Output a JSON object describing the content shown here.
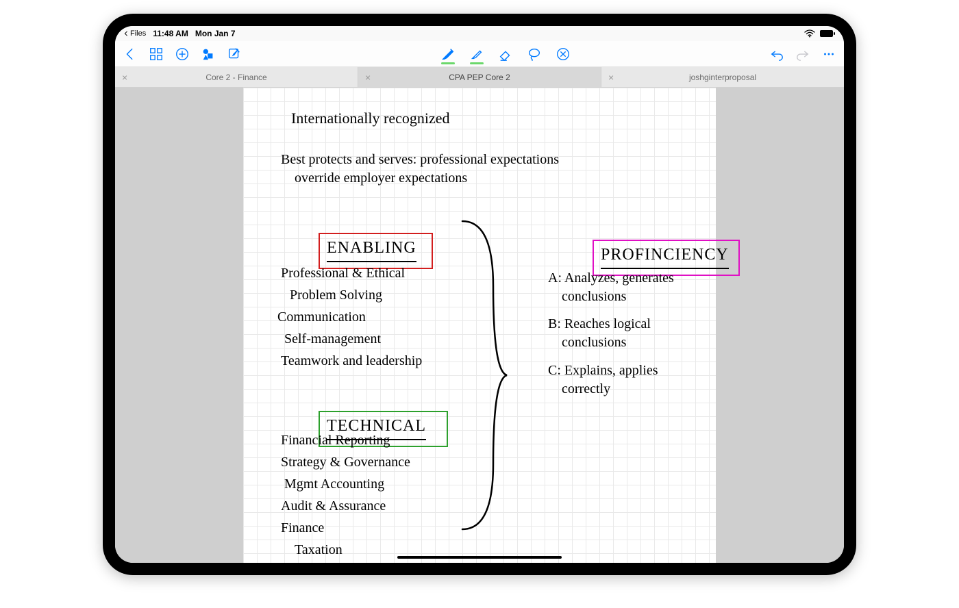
{
  "status": {
    "breadcrumb_app": "Files",
    "time": "11:48 AM",
    "date": "Mon Jan 7"
  },
  "tabs": [
    {
      "label": "Core 2 - Finance",
      "active": false
    },
    {
      "label": "CPA PEP Core 2",
      "active": true
    },
    {
      "label": "joshginterproposal",
      "active": false
    }
  ],
  "note": {
    "top_lines": [
      "Internationally recognized",
      "Best protects and serves: professional expectations\n    override employer expectations"
    ],
    "enabling": {
      "title": "ENABLING",
      "box_color": "#d21e1e",
      "items": [
        "Professional & Ethical",
        "Problem Solving",
        "Communication",
        "Self-management",
        "Teamwork and leadership"
      ]
    },
    "technical": {
      "title": "TECHNICAL",
      "box_color": "#2ca02c",
      "items": [
        "Financial Reporting",
        "Strategy & Governance",
        "Mgmt Accounting",
        "Audit & Assurance",
        "Finance",
        "Taxation"
      ]
    },
    "proficiency": {
      "title": "PROFINCIENCY",
      "box_color": "#e010c4",
      "levels": [
        "A: Analyzes, generates\n    conclusions",
        "B: Reaches logical\n    conclusions",
        "C: Explains, applies\n    correctly"
      ]
    }
  }
}
